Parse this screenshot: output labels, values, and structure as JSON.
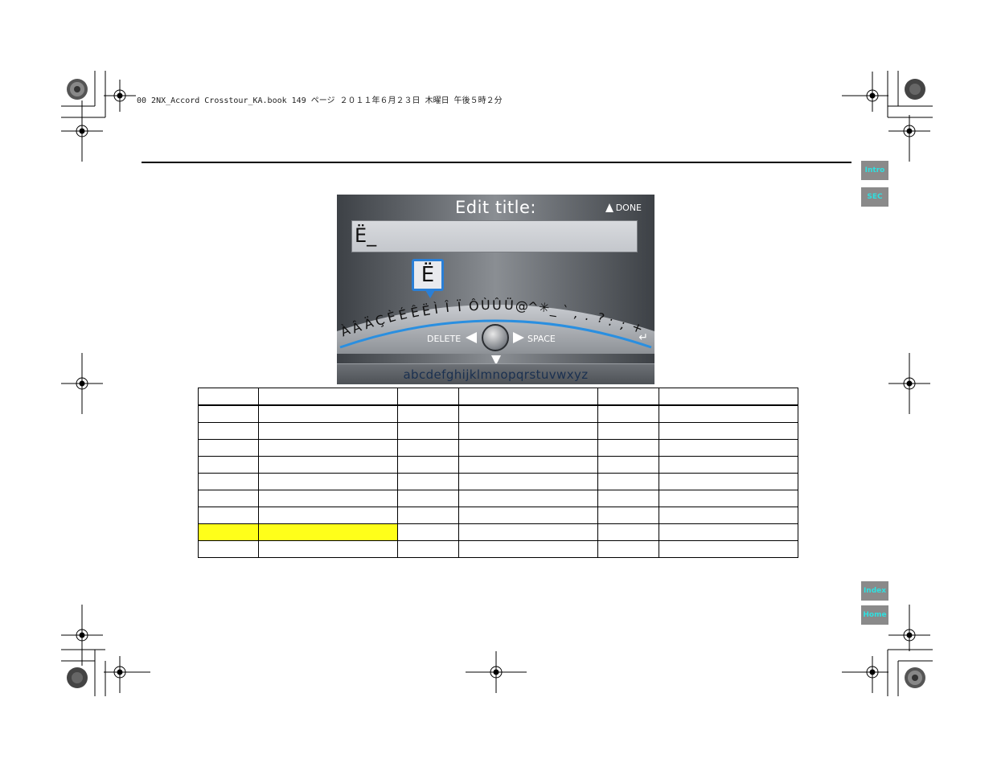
{
  "print_header": "00 2NX_Accord Crosstour_KA.book  149 ページ  ２０１１年６月２３日  木曜日  午後５時２分",
  "nav": {
    "intro": "Intro",
    "sec": "SEC",
    "index": "Index",
    "home": "Home",
    "button_text_color": "#2fe0e0",
    "button_bg": "#8a8a8a"
  },
  "screen": {
    "title": "Edit title:",
    "done_label": "DONE",
    "input_value": "Ë_",
    "selected_char": "Ë",
    "arc_chars": [
      "À",
      "Â",
      "Ä",
      "Ç",
      "È",
      "É",
      "Ê",
      "Ë",
      "Ì",
      "Î",
      "Ï",
      "Ô",
      "Ù",
      "Û",
      "Ü",
      "@",
      "^",
      "✳",
      "_",
      "`",
      ",",
      ".",
      "?",
      ":",
      ";",
      "+"
    ],
    "delete_label": "DELETE",
    "space_label": "SPACE",
    "enter_symbol": "↵",
    "alphabet_row": "abcdefghijklmnopqrstuvwxyz",
    "highlight_color": "#2a7fd6"
  },
  "table": {
    "rows": 10,
    "columns": 6,
    "highlight_row_index": 8,
    "highlight_columns": [
      0,
      1
    ],
    "highlight_color": "#ffff1a"
  }
}
